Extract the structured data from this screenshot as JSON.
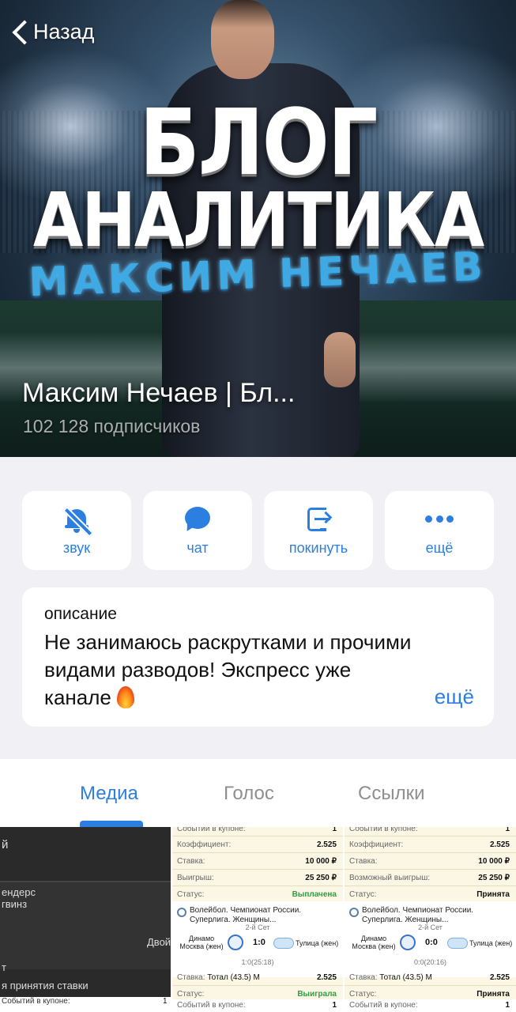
{
  "header": {
    "back_label": "Назад",
    "channel_name": "Максим Нечаев | Бл...",
    "subscribers": "102 128 подписчиков",
    "cover_text": {
      "line1": "БЛОГ",
      "line2": "АНАЛИТИКА",
      "line3": "МАКСИМ НЕЧАЕВ"
    }
  },
  "actions": [
    {
      "label": "звук",
      "icon": "bell-slash-icon"
    },
    {
      "label": "чат",
      "icon": "chat-bubble-icon"
    },
    {
      "label": "покинуть",
      "icon": "leave-icon"
    },
    {
      "label": "ещё",
      "icon": "more-dots-icon"
    }
  ],
  "description": {
    "label": "описание",
    "text": "Не занимаюсь раскрутками и прочими видами разводов! Экспресс уже канале",
    "more": "ещё"
  },
  "tabs": [
    {
      "label": "Медиа",
      "active": true
    },
    {
      "label": "Голос",
      "active": false
    },
    {
      "label": "Ссылки",
      "active": false
    }
  ],
  "media": {
    "dark": {
      "rows": [
        "й",
        "ендерс",
        "гвинз",
        "Двой",
        "т",
        "я принятия ставки",
        "Событий в купоне:"
      ],
      "row_end": "1"
    },
    "ticket1": {
      "top": "Событий в купоне:",
      "top_val": "1",
      "coef_label": "Коэффициент:",
      "coef": "2.525",
      "stake_label": "Ставка:",
      "stake": "10 000 ₽",
      "win_label": "Выигрыш:",
      "win": "25 250 ₽",
      "status_label": "Статус:",
      "status": "Выплачена",
      "match_title": "Волейбол. Чемпионат России. Суперлига. Женщины...",
      "set": "2-й Сет",
      "team1": "Динамо Москва (жен)",
      "score": "1:0",
      "team2": "Тулица (жен)",
      "detail": "1:0(25:18)",
      "bet_label": "Ставка:",
      "bet": "Тотал (43.5) М",
      "bet_coef": "2.525",
      "bet_status_label": "Статус:",
      "bet_status": "Выиграла",
      "bottom": "Событий в купоне:",
      "bottom_val": "1"
    },
    "ticket2": {
      "top": "Событий в купоне:",
      "top_val": "1",
      "coef_label": "Коэффициент:",
      "coef": "2.525",
      "stake_label": "Ставка:",
      "stake": "10 000 ₽",
      "win_label": "Возможный выигрыш:",
      "win": "25 250 ₽",
      "status_label": "Статус:",
      "status": "Принята",
      "match_title": "Волейбол. Чемпионат России. Суперлига. Женщины...",
      "set": "2-й Сет",
      "team1": "Динамо Москва (жен)",
      "score": "0:0",
      "team2": "Тулица (жен)",
      "detail": "0:0(20:16)",
      "bet_label": "Ставка:",
      "bet": "Тотал (43.5) М",
      "bet_coef": "2.525",
      "bet_status_label": "Статус:",
      "bet_status": "Принята",
      "bottom": "Событий в купоне:",
      "bottom_val": "1"
    }
  },
  "colors": {
    "accent": "#2c7fe0",
    "background": "#f0f0f5",
    "win_green": "#2f9e41"
  }
}
